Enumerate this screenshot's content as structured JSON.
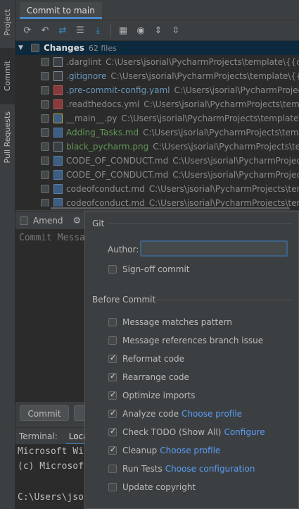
{
  "side_tabs": {
    "project": "Project",
    "commit": "Commit",
    "pull_requests": "Pull Requests"
  },
  "tool_window": {
    "title": "Commit to main"
  },
  "toolbar": {
    "icons": [
      "refresh-icon",
      "rollback-icon",
      "diff-icon",
      "shelve-icon",
      "download-icon",
      "group-by-icon",
      "view-options-icon",
      "expand-all-icon",
      "collapse-all-icon"
    ]
  },
  "changes": {
    "label": "Changes",
    "count": "62 files",
    "files": [
      {
        "name": ".darglint",
        "path": "C:\\Users\\jsorial\\PycharmProjects\\template\\{{cookiecutter.repo_name}}",
        "color": "gray",
        "icon": "text-file-icon"
      },
      {
        "name": ".gitignore",
        "path": "C:\\Users\\jsorial\\PycharmProjects\\template\\{{cookiecutter.repo_name}}",
        "color": "blue",
        "icon": "gitignore-file-icon"
      },
      {
        "name": ".pre-commit-config.yaml",
        "path": "C:\\Users\\jsorial\\PycharmProjects\\template\\{{cookiecutter.repo_name}}",
        "color": "blue",
        "icon": "yaml-file-icon"
      },
      {
        "name": ".readthedocs.yml",
        "path": "C:\\Users\\jsorial\\PycharmProjects\\template\\{{cookiecutter.repo_name}}",
        "color": "gray",
        "icon": "yaml-file-icon"
      },
      {
        "name": "__main__.py",
        "path": "C:\\Users\\jsorial\\PycharmProjects\\template\\{{cookiecutter.repo_name}}",
        "color": "gray",
        "icon": "python-file-icon"
      },
      {
        "name": "Adding_Tasks.md",
        "path": "C:\\Users\\jsorial\\PycharmProjects\\template\\docs",
        "color": "green",
        "icon": "markdown-file-icon"
      },
      {
        "name": "black_pycharm.png",
        "path": "C:\\Users\\jsorial\\PycharmProjects\\template\\docs",
        "color": "green",
        "icon": "image-file-icon"
      },
      {
        "name": "CODE_OF_CONDUCT.md",
        "path": "C:\\Users\\jsorial\\PycharmProjects\\template\\{{cookiecutter.repo_name}}",
        "color": "gray",
        "icon": "markdown-file-icon"
      },
      {
        "name": "CODE_OF_CONDUCT.md",
        "path": "C:\\Users\\jsorial\\PycharmProjects\\template\\{{cookiecutter.repo_name}}",
        "color": "gray",
        "icon": "markdown-file-icon"
      },
      {
        "name": "codeofconduct.md",
        "path": "C:\\Users\\jsorial\\PycharmProjects\\template\\{{cookiecutter.repo_name}}",
        "color": "gray",
        "icon": "markdown-file-icon"
      },
      {
        "name": "codeofconduct.md",
        "path": "C:\\Users\\jsorial\\PycharmProjects\\template\\{{cookiecutter.repo_name}}",
        "color": "gray",
        "icon": "markdown-file-icon"
      }
    ]
  },
  "amend": {
    "label": "Amend"
  },
  "commit_message": {
    "placeholder": "Commit Message"
  },
  "buttons": {
    "commit": "Commit"
  },
  "terminal": {
    "label": "Terminal:",
    "tab": "Local",
    "lines": [
      "Microsoft Windows",
      "(c) Microsoft",
      "",
      "C:\\Users\\jso"
    ]
  },
  "commit_options": {
    "git_section": "Git",
    "author_label": "Author:",
    "author_value": "",
    "signoff": {
      "label": "Sign-off commit",
      "checked": false
    },
    "before_commit_section": "Before Commit",
    "options": [
      {
        "label": "Message matches pattern",
        "checked": false,
        "link": ""
      },
      {
        "label": "Message references branch issue",
        "checked": false,
        "link": ""
      },
      {
        "label": "Reformat code",
        "checked": true,
        "link": ""
      },
      {
        "label": "Rearrange code",
        "checked": true,
        "link": ""
      },
      {
        "label": "Optimize imports",
        "checked": true,
        "link": ""
      },
      {
        "label": "Analyze code",
        "checked": true,
        "link": "Choose profile"
      },
      {
        "label": "Check TODO (Show All)",
        "checked": true,
        "link": "Configure"
      },
      {
        "label": "Cleanup",
        "checked": true,
        "link": "Choose profile"
      },
      {
        "label": "Run Tests",
        "checked": false,
        "link": "Choose configuration"
      },
      {
        "label": "Update copyright",
        "checked": false,
        "link": ""
      }
    ]
  },
  "colors": {
    "accent": "#4a88c7",
    "link": "#589df6",
    "selection": "#0d293e"
  }
}
